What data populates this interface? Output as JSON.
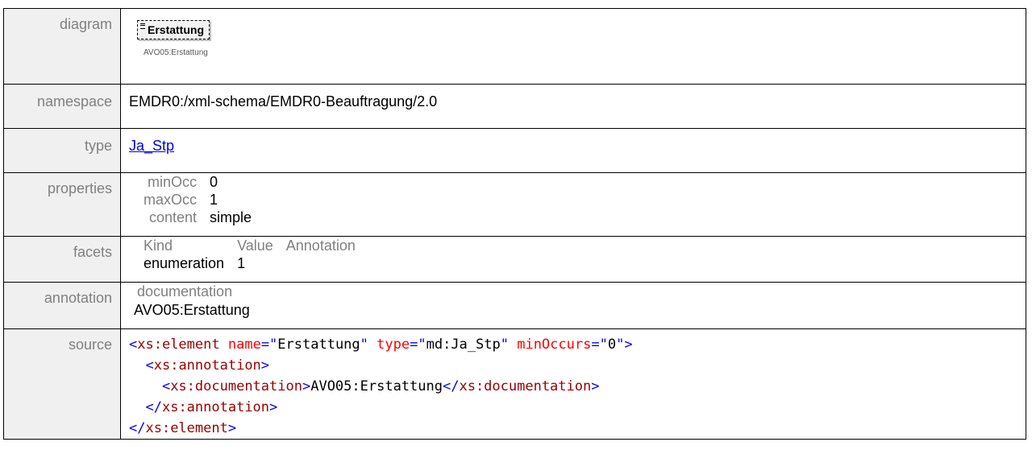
{
  "header": {
    "title": ""
  },
  "rows": {
    "diagram": {
      "label": "diagram",
      "element_name": "Erstattung",
      "element_caption": "AVO05:Erstattung"
    },
    "namespace": {
      "label": "namespace",
      "value": "EMDR0:/xml-schema/EMDR0-Beauftragung/2.0"
    },
    "type": {
      "label": "type",
      "link_text": "Ja_Stp"
    },
    "properties": {
      "label": "properties",
      "items": [
        {
          "key": "minOcc",
          "value": "0"
        },
        {
          "key": "maxOcc",
          "value": "1"
        },
        {
          "key": "content",
          "value": "simple"
        }
      ]
    },
    "facets": {
      "label": "facets",
      "headers": [
        "Kind",
        "Value",
        "Annotation"
      ],
      "rows": [
        {
          "kind": "enumeration",
          "value": "1",
          "annotation": ""
        }
      ]
    },
    "annotation": {
      "label": "annotation",
      "header": "documentation",
      "value": "AVO05:Erstattung"
    },
    "source": {
      "label": "source",
      "lines": [
        [
          {
            "c": "t-bracket",
            "t": "<"
          },
          {
            "c": "t-name",
            "t": "xs:element"
          },
          {
            "c": "t-text",
            "t": " "
          },
          {
            "c": "t-attr",
            "t": "name"
          },
          {
            "c": "t-bracket",
            "t": "=\""
          },
          {
            "c": "t-val",
            "t": "Erstattung"
          },
          {
            "c": "t-bracket",
            "t": "\""
          },
          {
            "c": "t-text",
            "t": " "
          },
          {
            "c": "t-attr",
            "t": "type"
          },
          {
            "c": "t-bracket",
            "t": "=\""
          },
          {
            "c": "t-val",
            "t": "md:Ja_Stp"
          },
          {
            "c": "t-bracket",
            "t": "\""
          },
          {
            "c": "t-text",
            "t": " "
          },
          {
            "c": "t-attr",
            "t": "minOccurs"
          },
          {
            "c": "t-bracket",
            "t": "=\""
          },
          {
            "c": "t-val",
            "t": "0"
          },
          {
            "c": "t-bracket",
            "t": "\">"
          }
        ],
        [
          {
            "c": "t-text",
            "t": "  "
          },
          {
            "c": "t-bracket",
            "t": "<"
          },
          {
            "c": "t-name",
            "t": "xs:annotation"
          },
          {
            "c": "t-bracket",
            "t": ">"
          }
        ],
        [
          {
            "c": "t-text",
            "t": "    "
          },
          {
            "c": "t-bracket",
            "t": "<"
          },
          {
            "c": "t-name",
            "t": "xs:documentation"
          },
          {
            "c": "t-bracket",
            "t": ">"
          },
          {
            "c": "t-text",
            "t": "AVO05:Erstattung"
          },
          {
            "c": "t-bracket",
            "t": "</"
          },
          {
            "c": "t-name",
            "t": "xs:documentation"
          },
          {
            "c": "t-bracket",
            "t": ">"
          }
        ],
        [
          {
            "c": "t-text",
            "t": "  "
          },
          {
            "c": "t-bracket",
            "t": "</"
          },
          {
            "c": "t-name",
            "t": "xs:annotation"
          },
          {
            "c": "t-bracket",
            "t": ">"
          }
        ],
        [
          {
            "c": "t-bracket",
            "t": "</"
          },
          {
            "c": "t-name",
            "t": "xs:element"
          },
          {
            "c": "t-bracket",
            "t": ">"
          }
        ]
      ]
    }
  }
}
